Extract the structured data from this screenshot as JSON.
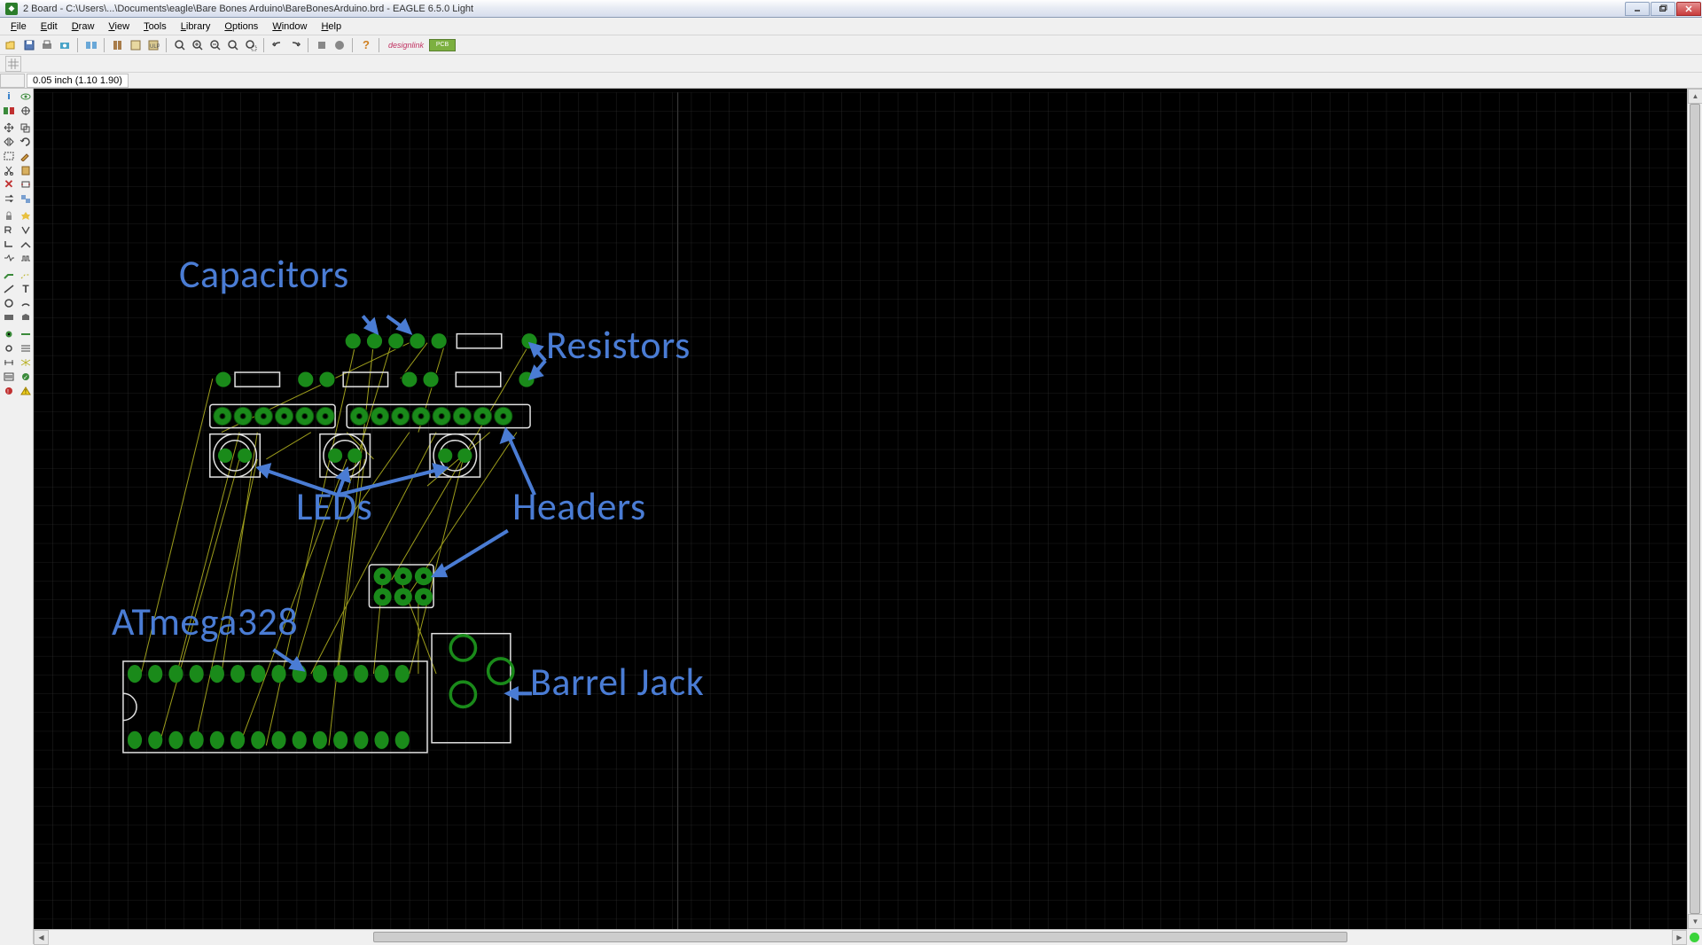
{
  "title": "2 Board - C:\\Users\\...\\Documents\\eagle\\Bare Bones Arduino\\BareBonesArduino.brd - EAGLE 6.5.0 Light",
  "menu": [
    "File",
    "Edit",
    "Draw",
    "View",
    "Tools",
    "Library",
    "Options",
    "Window",
    "Help"
  ],
  "coord_text": "0.05 inch (1.10 1.90)",
  "annotations": {
    "capacitors": "Capacitors",
    "resistors": "Resistors",
    "leds": "LEDs",
    "headers": "Headers",
    "atmega": "ATmega328",
    "barrel_jack": "Barrel Jack"
  },
  "design_link": "designlink",
  "pcb_quote": "PCB"
}
